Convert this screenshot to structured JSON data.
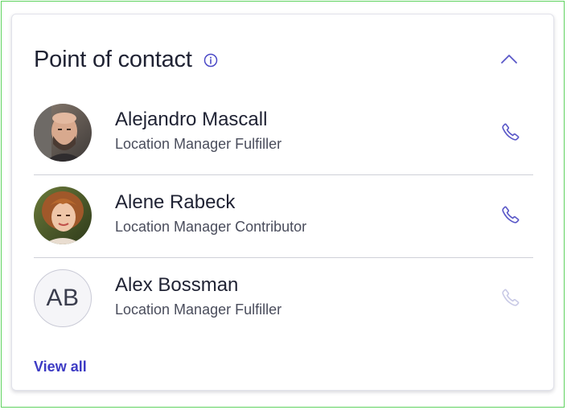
{
  "card": {
    "title": "Point of contact",
    "view_all_label": "View all"
  },
  "icons": {
    "info": "info-icon",
    "collapse": "chevron-up-icon",
    "phone": "phone-icon"
  },
  "colors": {
    "accent": "#3d3bc4",
    "icon": "#5a58c8",
    "icon_disabled": "#c9cae6",
    "text_primary": "#1f2233",
    "text_secondary": "#4a4d5c",
    "divider": "#cfd0d8",
    "frame": "#5fd35f"
  },
  "contacts": [
    {
      "name": "Alejandro Mascall",
      "role": "Location Manager Fulfiller",
      "avatar": "photo",
      "phone_enabled": true
    },
    {
      "name": "Alene Rabeck",
      "role": "Location Manager Contributor",
      "avatar": "photo",
      "phone_enabled": true
    },
    {
      "name": "Alex Bossman",
      "role": "Location Manager Fulfiller",
      "avatar_initials": "AB",
      "phone_enabled": false
    }
  ]
}
